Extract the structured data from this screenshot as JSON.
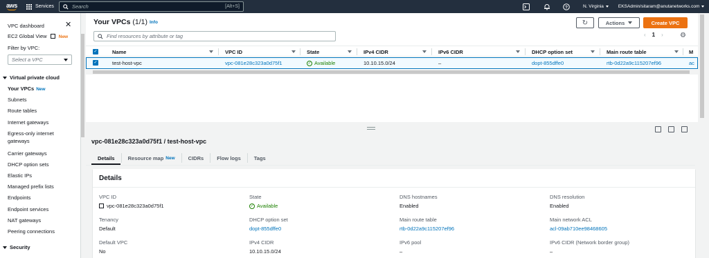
{
  "topnav": {
    "logo": "aws",
    "services": "Services",
    "search_placeholder": "Search",
    "search_shortcut": "[Alt+S]",
    "region": "N. Virginia",
    "account": "EKSAdmin/sitaram@anutanetworks.com"
  },
  "sidebar": {
    "vpc_dashboard": "VPC dashboard",
    "ec2_global_view": "EC2 Global View",
    "new_label": "New",
    "filter_by_vpc": "Filter by VPC:",
    "select_vpc_placeholder": "Select a VPC",
    "section_vpc": "Virtual private cloud",
    "items": [
      "Your VPCs",
      "Subnets",
      "Route tables",
      "Internet gateways",
      "Egress-only internet",
      "gateways",
      "Carrier gateways",
      "DHCP option sets",
      "Elastic IPs",
      "Managed prefix lists",
      "Endpoints",
      "Endpoint services",
      "NAT gateways",
      "Peering connections"
    ],
    "section_security": "Security"
  },
  "vpc_panel": {
    "title": "Your VPCs",
    "count": "(1/1)",
    "info": "Info",
    "actions": "Actions",
    "create": "Create VPC",
    "filter_placeholder": "Find resources by attribute or tag",
    "page": "1",
    "columns": [
      "Name",
      "VPC ID",
      "State",
      "IPv4 CIDR",
      "IPv6 CIDR",
      "DHCP option set",
      "Main route table",
      "M"
    ],
    "row": {
      "name": "test-host-vpc",
      "vpc_id": "vpc-081e28c323a0d75f1",
      "state": "Available",
      "ipv4": "10.10.15.0/24",
      "ipv6": "–",
      "dhcp": "dopt-855dffe0",
      "route_table": "rtb-0d22a9c115207ef96",
      "acl": "ac"
    }
  },
  "details": {
    "heading": "vpc-081e28c323a0d75f1 / test-host-vpc",
    "tabs": [
      "Details",
      "Resource map",
      "CIDRs",
      "Flow logs",
      "Tags"
    ],
    "tab_new": "New",
    "card_title": "Details",
    "fields": {
      "vpc_id_label": "VPC ID",
      "vpc_id_value": "vpc-081e28c323a0d75f1",
      "state_label": "State",
      "state_value": "Available",
      "dns_hostnames_label": "DNS hostnames",
      "dns_hostnames_value": "Enabled",
      "dns_resolution_label": "DNS resolution",
      "dns_resolution_value": "Enabled",
      "tenancy_label": "Tenancy",
      "tenancy_value": "Default",
      "dhcp_label": "DHCP option set",
      "dhcp_value": "dopt-855dffe0",
      "route_table_label": "Main route table",
      "route_table_value": "rtb-0d22a9c115207ef96",
      "acl_label": "Main network ACL",
      "acl_value": "acl-09ab710ee98468605",
      "default_vpc_label": "Default VPC",
      "default_vpc_value": "No",
      "ipv4_label": "IPv4 CIDR",
      "ipv4_value": "10.10.15.0/24",
      "ipv6_pool_label": "IPv6 pool",
      "ipv6_pool_value": "–",
      "ipv6_cidr_label": "IPv6 CIDR (Network border group)",
      "ipv6_cidr_value": "–"
    }
  },
  "colors": {
    "nav_bg": "#232f3e",
    "accent_orange": "#ec7211",
    "link_blue": "#0073bb",
    "available_green": "#1d8102"
  }
}
